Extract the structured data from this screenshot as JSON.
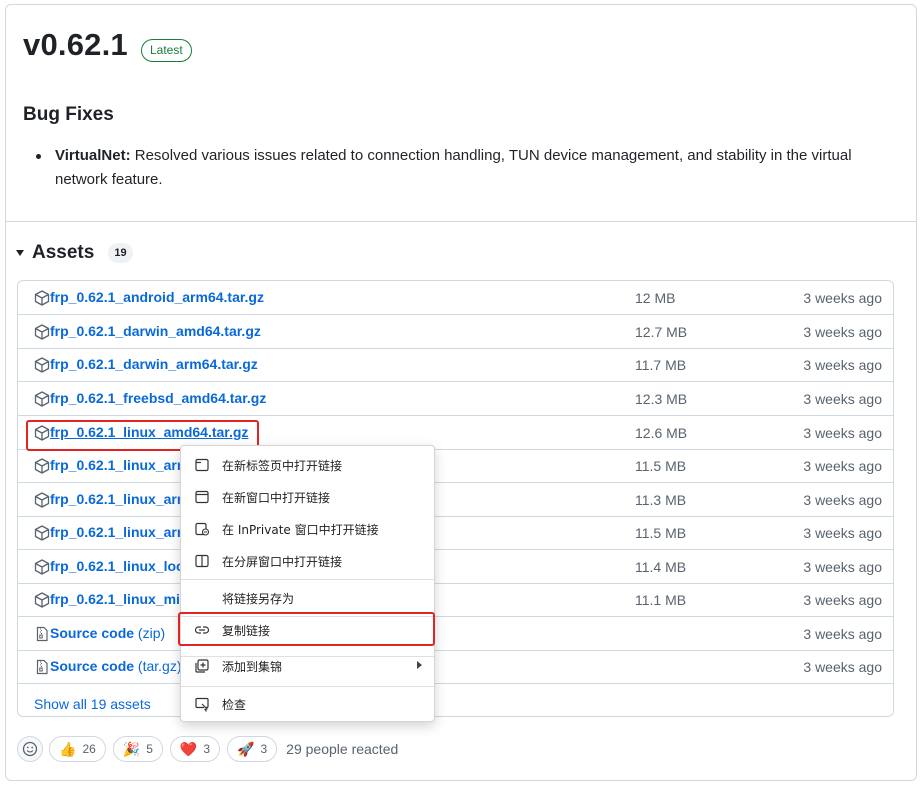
{
  "release": {
    "version": "v0.62.1",
    "badge": "Latest",
    "section_title": "Bug Fixes",
    "fix_title": "VirtualNet:",
    "fix_text": " Resolved various issues related to connection handling, TUN device management, and stability in the virtual network feature."
  },
  "assets": {
    "title": "Assets",
    "count": "19",
    "rows": [
      {
        "name": "frp_0.62.1_android_arm64.tar.gz",
        "size": "12 MB",
        "date": "3 weeks ago",
        "icon": "package-icon"
      },
      {
        "name": "frp_0.62.1_darwin_amd64.tar.gz",
        "size": "12.7 MB",
        "date": "3 weeks ago",
        "icon": "package-icon"
      },
      {
        "name": "frp_0.62.1_darwin_arm64.tar.gz",
        "size": "11.7 MB",
        "date": "3 weeks ago",
        "icon": "package-icon"
      },
      {
        "name": "frp_0.62.1_freebsd_amd64.tar.gz",
        "size": "12.3 MB",
        "date": "3 weeks ago",
        "icon": "package-icon"
      },
      {
        "name": "frp_0.62.1_linux_amd64.tar.gz",
        "size": "12.6 MB",
        "date": "3 weeks ago",
        "icon": "package-icon"
      },
      {
        "name": "frp_0.62.1_linux_arm",
        "size": "11.5 MB",
        "date": "3 weeks ago",
        "icon": "package-icon"
      },
      {
        "name": "frp_0.62.1_linux_arm",
        "size": "11.3 MB",
        "date": "3 weeks ago",
        "icon": "package-icon"
      },
      {
        "name": "frp_0.62.1_linux_arm",
        "size": "11.5 MB",
        "date": "3 weeks ago",
        "icon": "package-icon"
      },
      {
        "name": "frp_0.62.1_linux_loon",
        "size": "11.4 MB",
        "date": "3 weeks ago",
        "icon": "package-icon"
      },
      {
        "name": "frp_0.62.1_linux_mip",
        "size": "11.1 MB",
        "date": "3 weeks ago",
        "icon": "package-icon"
      },
      {
        "name": "Source code",
        "suffix": " (zip)",
        "size": "",
        "date": "3 weeks ago",
        "icon": "file-zip-icon"
      },
      {
        "name": "Source code",
        "suffix": " (tar.gz)",
        "size": "",
        "date": "3 weeks ago",
        "icon": "file-zip-icon"
      }
    ],
    "show_all": "Show all 19 assets"
  },
  "reactions": {
    "items": [
      {
        "emoji": "👍",
        "count": "26"
      },
      {
        "emoji": "🎉",
        "count": "5"
      },
      {
        "emoji": "❤️",
        "count": "3"
      },
      {
        "emoji": "🚀",
        "count": "3"
      }
    ],
    "summary": "29 people reacted"
  },
  "context_menu": {
    "items": [
      {
        "label": "在新标签页中打开链接",
        "icon": "new-tab-icon"
      },
      {
        "label": "在新窗口中打开链接",
        "icon": "new-window-icon"
      },
      {
        "label": "在 InPrivate 窗口中打开链接",
        "icon": "inprivate-icon"
      },
      {
        "label": "在分屏窗口中打开链接",
        "icon": "split-screen-icon"
      },
      {
        "label": "将链接另存为",
        "icon": ""
      },
      {
        "label": "复制链接",
        "icon": "link-icon"
      },
      {
        "label": "添加到集锦",
        "icon": "collections-icon"
      },
      {
        "label": "检查",
        "icon": "inspect-icon"
      }
    ]
  },
  "colors": {
    "link": "#0969da",
    "latest": "#1a7f37",
    "highlight": "#e02424",
    "muted": "#59636e"
  }
}
